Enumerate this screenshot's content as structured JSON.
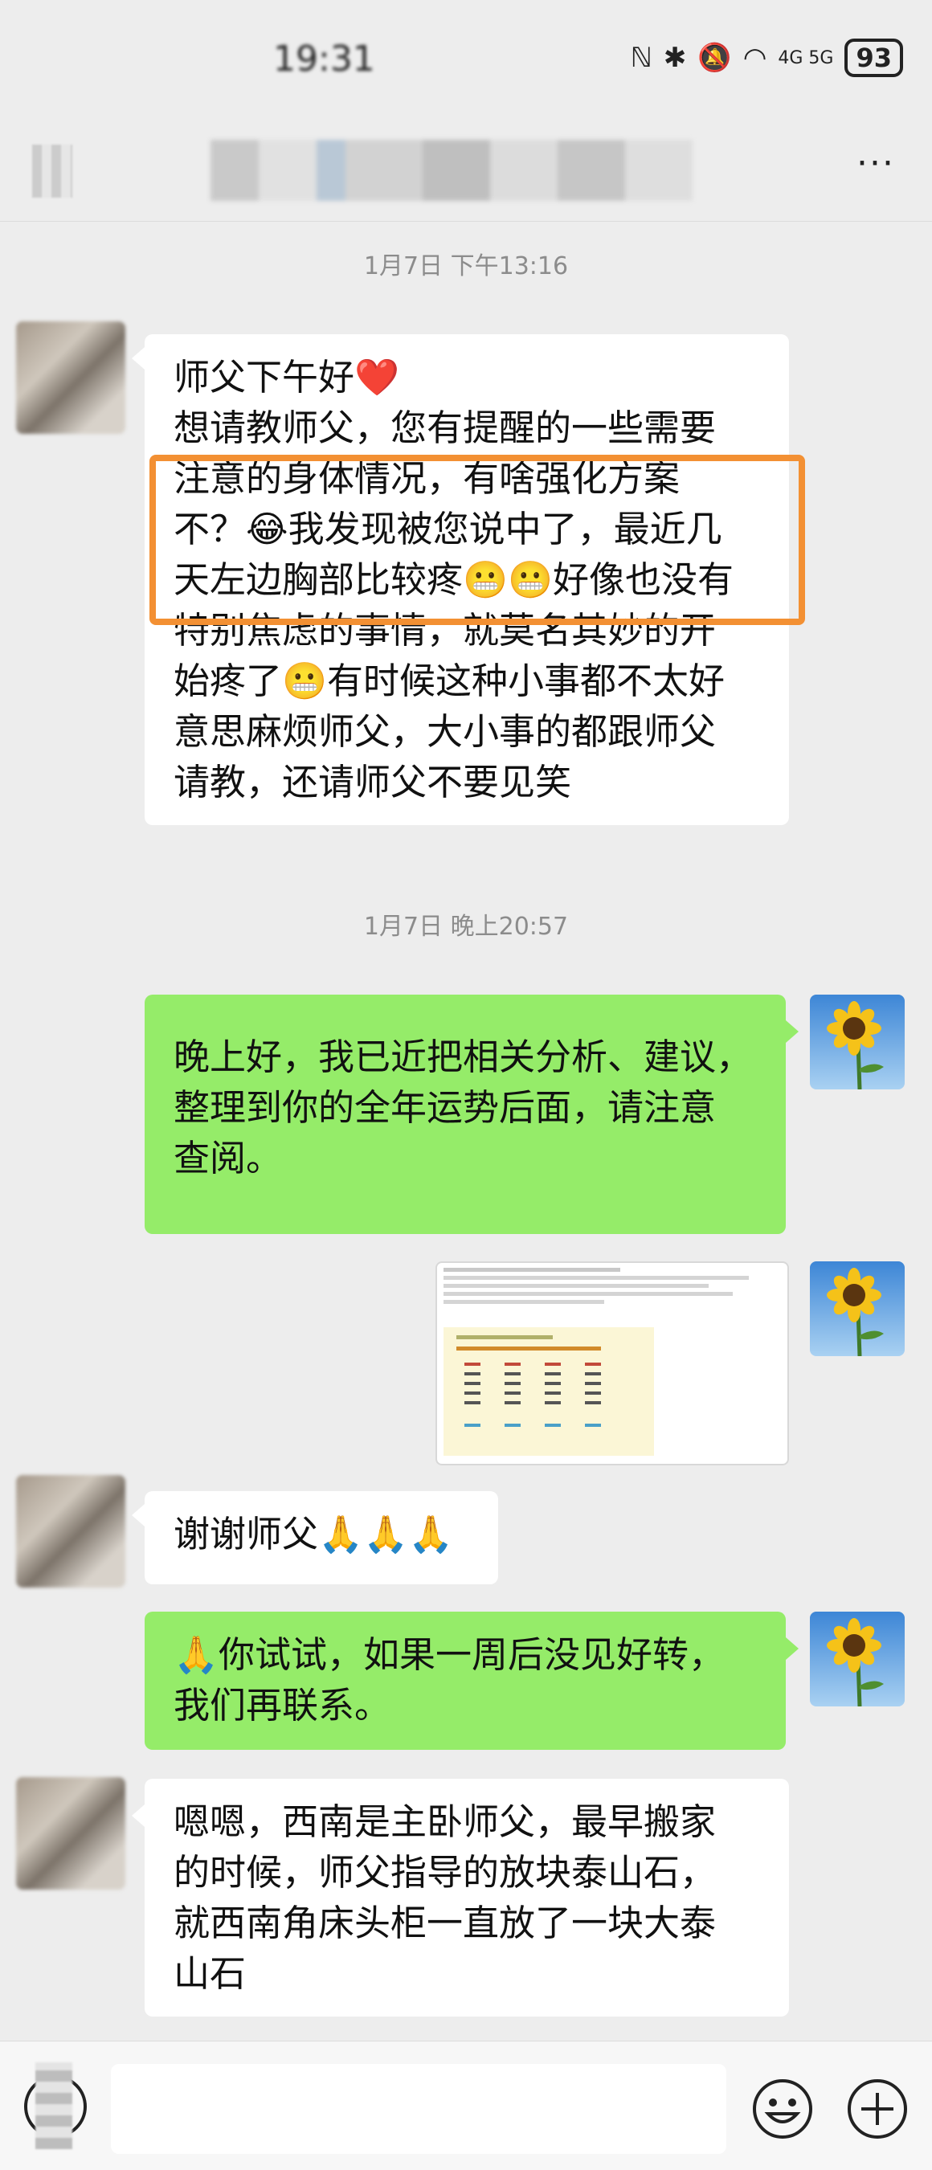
{
  "status_bar": {
    "time": "19:31",
    "network": "4G 5G",
    "battery": "93"
  },
  "nav": {
    "more_label": "···"
  },
  "messages": [
    {
      "type": "timestamp",
      "text": "1月7日 下午13:16"
    },
    {
      "type": "left",
      "lines": [
        "师父下午好❤️",
        "想请教师父，您有提醒的一些需要",
        "注意的身体情况，有啥强化方案",
        "不？😂我发现被您说中了，最近几",
        "天左边胸部比较疼😬😬好像也没有",
        "特别焦虑的事情，就莫名其妙的开",
        "始疼了😬有时候这种小事都不太好",
        "意思麻烦师父，大小事的都跟师父",
        "请教，还请师父不要见笑"
      ]
    },
    {
      "type": "timestamp",
      "text": "1月7日 晚上20:57"
    },
    {
      "type": "right",
      "lines": [
        "晚上好，我已近把相关分析、建议，",
        "整理到你的全年运势后面，请注意",
        "查阅。"
      ]
    },
    {
      "type": "left",
      "text": "谢谢师父🙏🙏🙏"
    },
    {
      "type": "right",
      "lines": [
        "🙏你试试，如果一周后没见好转，",
        "我们再联系。"
      ]
    },
    {
      "type": "left",
      "lines": [
        "嗯嗯，西南是主卧师父，最早搬家",
        "的时候，师父指导的放块泰山石，",
        "就西南角床头柜一直放了一块大泰",
        "山石"
      ]
    }
  ],
  "colors": {
    "highlight": "#f39033",
    "sent_bubble": "#95ec69",
    "received_bubble": "#ffffff"
  }
}
